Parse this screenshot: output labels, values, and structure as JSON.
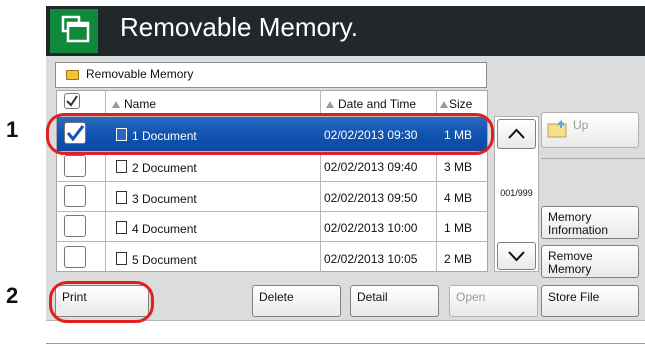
{
  "header": {
    "title": "Removable Memory."
  },
  "path": {
    "label": "Removable Memory"
  },
  "table": {
    "columns": [
      "Name",
      "Date and Time",
      "Size"
    ],
    "rows": [
      {
        "name": "1 Document",
        "date": "02/02/2013 09:30",
        "size": "1 MB",
        "checked": true,
        "selected": true
      },
      {
        "name": "2 Document",
        "date": "02/02/2013 09:40",
        "size": "3 MB",
        "checked": false,
        "selected": false
      },
      {
        "name": "3 Document",
        "date": "02/02/2013 09:50",
        "size": "4 MB",
        "checked": false,
        "selected": false
      },
      {
        "name": "4 Document",
        "date": "02/02/2013 10:00",
        "size": "1 MB",
        "checked": false,
        "selected": false
      },
      {
        "name": "5 Document",
        "date": "02/02/2013 10:05",
        "size": "2 MB",
        "checked": false,
        "selected": false
      }
    ]
  },
  "pagination": {
    "indicator": "001/999"
  },
  "side": {
    "up": "Up",
    "memory_info": "Memory Information",
    "remove_memory": "Remove Memory",
    "store_file": "Store File"
  },
  "bottom": {
    "print": "Print",
    "delete": "Delete",
    "detail": "Detail",
    "open": "Open"
  },
  "callouts": {
    "one": "1",
    "two": "2"
  },
  "colors": {
    "selection": "#1253b0",
    "callout_ring": "#e02020",
    "app_icon": "#0f8a3a",
    "title_bar": "#22272b"
  }
}
